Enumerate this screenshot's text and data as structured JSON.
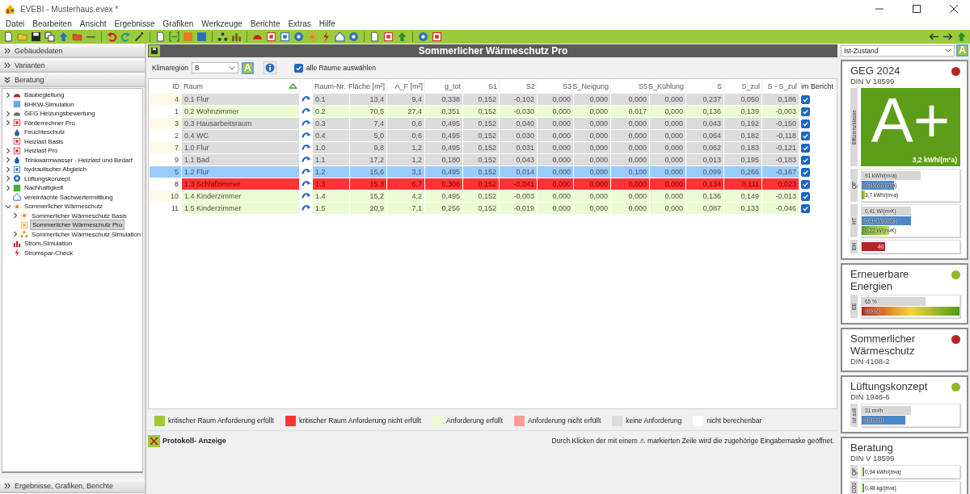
{
  "window": {
    "title": "EVEBI - Musterhaus.evex *"
  },
  "menu": [
    "Datei",
    "Bearbeiten",
    "Ansicht",
    "Ergebnisse",
    "Grafiken",
    "Werkzeuge",
    "Berichte",
    "Extras",
    "Hilfe"
  ],
  "sidebar": {
    "sections": [
      {
        "label": "Gebäudedaten",
        "expanded": false
      },
      {
        "label": "Varianten",
        "expanded": false
      },
      {
        "label": "Beratung",
        "expanded": true,
        "items": [
          {
            "label": "Baubegleitung",
            "expanded": false,
            "selected": false
          },
          {
            "label": "BHKW-Simulation",
            "selected": false
          },
          {
            "label": "GEG Heizungsbewertung",
            "expanded": false,
            "selected": false
          },
          {
            "label": "Förderrechner Pro",
            "expanded": false,
            "selected": false
          },
          {
            "label": "Feuchteschutz",
            "selected": false
          },
          {
            "label": "Heizlast Basis",
            "selected": false
          },
          {
            "label": "Heizlast Pro",
            "expanded": false,
            "selected": false
          },
          {
            "label": "Trinkwarmwasser - Heizlast und Bedarf",
            "expanded": false,
            "selected": false
          },
          {
            "label": "hydraulischer Abgleich",
            "expanded": false,
            "selected": false
          },
          {
            "label": "Lüftungskonzept",
            "expanded": false,
            "selected": false
          },
          {
            "label": "Nachhaltigkeit",
            "expanded": false,
            "selected": false
          },
          {
            "label": "vereinfachte Sachwertermittlung",
            "selected": false
          },
          {
            "label": "Sommerlicher Wärmeschutz",
            "expanded": true,
            "selected": false,
            "children": [
              {
                "label": "Sommerlicher Wärmeschutz Basis",
                "expanded": false,
                "selected": false
              },
              {
                "label": "Sommerlicher Wärmeschutz Pro",
                "selected": true
              },
              {
                "label": "Sommerlicher Wärmeschutz Simulation",
                "expanded": false,
                "selected": false
              }
            ]
          },
          {
            "label": "Strom-Simulation",
            "selected": false
          },
          {
            "label": "Stromspar-Check",
            "selected": false
          }
        ]
      },
      {
        "label": "Ergebnisse, Grafiken, Berichte",
        "expanded": false
      }
    ]
  },
  "panel": {
    "title": "Sommerlicher Wärmeschutz Pro",
    "klimaregion": {
      "label": "Klimaregion",
      "value": "B"
    },
    "mode_button": "A",
    "select_all": {
      "label": "alle Räume auswählen",
      "checked": true
    }
  },
  "table": {
    "columns": [
      {
        "label": "ID",
        "kind": "number"
      },
      {
        "label": "Raum",
        "kind": "text",
        "sorted": true
      },
      {
        "kind": "link"
      },
      {
        "label": "Raum-Nr.",
        "kind": "text"
      },
      {
        "label": "Fläche [m²]",
        "kind": "number"
      },
      {
        "label": "A_F [m²]",
        "kind": "number"
      },
      {
        "label": "g_tot",
        "kind": "number"
      },
      {
        "label": "S1",
        "kind": "number"
      },
      {
        "label": "S2",
        "kind": "number"
      },
      {
        "label": "S3",
        "kind": "number"
      },
      {
        "label": "S_Neigung",
        "kind": "number"
      },
      {
        "label": "S5",
        "kind": "number"
      },
      {
        "label": "S_Kühlung",
        "kind": "number"
      },
      {
        "label": "S",
        "kind": "number"
      },
      {
        "label": "S_zul",
        "kind": "number"
      },
      {
        "label": "S - S_zul",
        "kind": "number"
      },
      {
        "label": "im Bericht",
        "kind": "check"
      }
    ],
    "rows": [
      {
        "cells": [
          "4",
          "0.1 Flur",
          "",
          "0.1",
          "13,4",
          "9,4",
          "0,338",
          "0,152",
          "-0,102",
          "0,000",
          "0,000",
          "0,000",
          "0,000",
          "0,237",
          "0,050",
          "0,186"
        ],
        "im_bericht": true,
        "color": "#dcdcdc",
        "selected": false
      },
      {
        "cells": [
          "1",
          "0.2 Wohnzimmer",
          "",
          "0.2",
          "70,5",
          "27,4",
          "0,351",
          "0,152",
          "-0,030",
          "0,000",
          "0,000",
          "0,017",
          "0,000",
          "0,136",
          "0,139",
          "-0,003"
        ],
        "im_bericht": true,
        "color": "#ecfbd2",
        "selected": false
      },
      {
        "cells": [
          "3",
          "0.3 Hausarbeitsraum",
          "",
          "0.3",
          "7,4",
          "0,6",
          "0,495",
          "0,152",
          "0,040",
          "0,000",
          "0,000",
          "0,000",
          "0,000",
          "0,043",
          "0,192",
          "-0,150"
        ],
        "im_bericht": true,
        "color": "#dcdcdc",
        "selected": false
      },
      {
        "cells": [
          "2",
          "0.4 WC",
          "",
          "0.4",
          "5,0",
          "0,6",
          "0,495",
          "0,152",
          "0,030",
          "0,000",
          "0,000",
          "0,000",
          "0,000",
          "0,064",
          "0,182",
          "-0,118"
        ],
        "im_bericht": true,
        "color": "#dcdcdc",
        "selected": false
      },
      {
        "cells": [
          "7",
          "1.0 Flur",
          "",
          "1.0",
          "9,8",
          "1,2",
          "0,495",
          "0,152",
          "0,031",
          "0,000",
          "0,000",
          "0,000",
          "0,000",
          "0,062",
          "0,183",
          "-0,121"
        ],
        "im_bericht": true,
        "color": "#dcdcdc",
        "selected": false
      },
      {
        "cells": [
          "9",
          "1.1 Bad",
          "",
          "1.1",
          "17,2",
          "1,2",
          "0,180",
          "0,152",
          "0,043",
          "0,000",
          "0,000",
          "0,000",
          "0,000",
          "0,013",
          "0,195",
          "-0,183"
        ],
        "im_bericht": true,
        "color": "#dcdcdc",
        "selected": false
      },
      {
        "cells": [
          "5",
          "1.2 Flur",
          "",
          "1.2",
          "15,6",
          "3,1",
          "0,495",
          "0,152",
          "0,014",
          "0,000",
          "0,000",
          "0,100",
          "0,000",
          "0,099",
          "0,266",
          "-0,167"
        ],
        "im_bericht": true,
        "selected": true
      },
      {
        "cells": [
          "8",
          "1.3 Schlafzimmer",
          "",
          "1.3",
          "15,3",
          "6,7",
          "0,306",
          "0,152",
          "-0,041",
          "0,000",
          "0,000",
          "0,000",
          "0,000",
          "0,134",
          "0,111",
          "0,023"
        ],
        "im_bericht": true,
        "color": "#ff3333",
        "selected": false
      },
      {
        "cells": [
          "10",
          "1.4 Kinderzimmer",
          "",
          "1.4",
          "15,2",
          "4,2",
          "0,495",
          "0,152",
          "-0,003",
          "0,000",
          "0,000",
          "0,000",
          "0,000",
          "0,136",
          "0,149",
          "-0,013"
        ],
        "im_bericht": true,
        "color": "#ecfbd2",
        "selected": false
      },
      {
        "cells": [
          "11",
          "1.5 Kinderzimmer",
          "",
          "1.5",
          "20,9",
          "7,1",
          "0,256",
          "0,152",
          "-0,019",
          "0,000",
          "0,000",
          "0,000",
          "0,000",
          "0,087",
          "0,133",
          "-0,046"
        ],
        "im_bericht": true,
        "color": "#ecfbd2",
        "selected": false
      }
    ]
  },
  "legend": [
    {
      "label": "kritischer Raum Anforderung erfüllt",
      "color": "#a4c639"
    },
    {
      "label": "kritischer Raum Anforderung nicht erfüllt",
      "color": "#ff3333"
    },
    {
      "label": "Anforderung erfüllt",
      "color": "#ecfbd2"
    },
    {
      "label": "Anforderung nicht erfüllt",
      "color": "#ff9999"
    },
    {
      "label": "keine Anforderung",
      "color": "#dcdcdc"
    },
    {
      "label": "nicht berechenbar",
      "color": "#ffffff"
    }
  ],
  "protocol": {
    "label": "Protokoll- Anzeige",
    "hint": "Durch Klicken der mit einem ⚠ markierten Zeile wird die zugehörige Eingabemaske geöffnet."
  },
  "results": {
    "variant": "Ist-Zustand",
    "mode_button": "A",
    "cards": [
      {
        "title": "GEG 2024",
        "subtitle": "DIN V 18599",
        "color": "#b52525",
        "efficiency": {
          "label": "Effizienzklasse",
          "class": "A+",
          "value": "3,2 kWh/(m²a)"
        },
        "groups": [
          {
            "label": "QP",
            "bars": [
              {
                "text": "91 kWh/(m²a)",
                "kind": "grey",
                "level": 0.6
              },
              {
                "text": "60 kWh/(m²a)",
                "kind": "blue",
                "level": 0.33
              },
              {
                "text": "3,7 kWh/(m²a)",
                "kind": "green",
                "level": 0.03
              }
            ]
          },
          {
            "label": "HT",
            "bars": [
              {
                "text": "0,41 W/(m²K)",
                "kind": "grey",
                "level": 0.5
              },
              {
                "text": "0,41 W/(m²K)",
                "kind": "blue",
                "level": 0.5
              },
              {
                "text": "0,22 W/(m²K)",
                "kind": "green",
                "level": 0.28
              }
            ]
          },
          {
            "label": "EH",
            "bars": [
              {
                "text": "40",
                "kind": "red",
                "level": 0.24
              }
            ]
          }
        ]
      },
      {
        "title": "Erneuerbare Energien",
        "color": "#8dbb25",
        "groups": [
          {
            "label": "EE",
            "bars": [
              {
                "text": "65 %",
                "kind": "grey",
                "level": 0.65
              },
              {
                "text": "100 %",
                "kind": "spectrum",
                "level": 1
              }
            ]
          }
        ]
      },
      {
        "title": "Sommerlicher Wärmeschutz",
        "subtitle": "DIN 4108-2",
        "color": "#b52525"
      },
      {
        "title": "Lüftungskonzept",
        "subtitle": "DIN 1946-6",
        "color": "#8dbb25",
        "groups": [
          {
            "label": "ist soll",
            "bars": [
              {
                "text": "31 m³/h",
                "kind": "grey",
                "level": 0.5
              },
              {
                "text": "29 m³/h",
                "kind": "blue",
                "level": 0.45
              }
            ]
          }
        ]
      },
      {
        "title": "Beratung",
        "subtitle": "DIN V 18599",
        "groups": [
          {
            "label": "QP",
            "bars": [
              {
                "text": "0,94 kWh/(m²a)",
                "kind": "marker"
              }
            ]
          },
          {
            "label": "CO2",
            "bars": [
              {
                "text": "0,48 kg/(m²a)",
                "kind": "marker"
              }
            ]
          }
        ]
      }
    ]
  }
}
